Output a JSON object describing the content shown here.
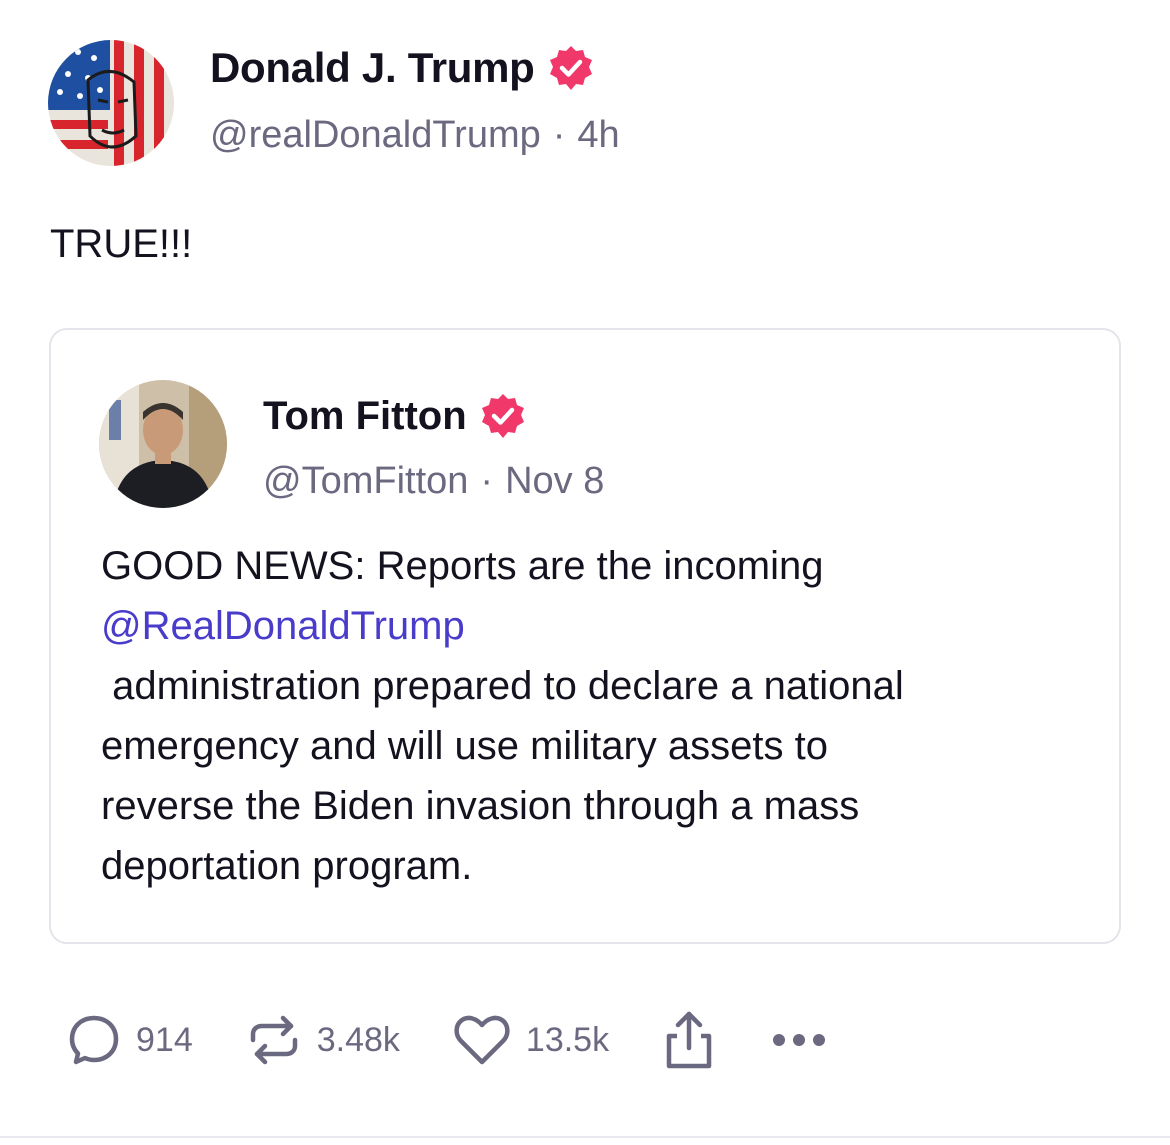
{
  "post": {
    "author": {
      "display_name": "Donald J. Trump",
      "handle": "@realDonaldTrump",
      "time": "4h",
      "verified_icon": "verified-badge-icon",
      "badge_color": "#f0386a"
    },
    "text": "TRUE!!!",
    "quoted": {
      "author": {
        "display_name": "Tom Fitton",
        "handle": "@TomFitton",
        "time": "Nov 8"
      },
      "lines": {
        "l1": "GOOD NEWS: Reports are the incoming",
        "mention": "@RealDonaldTrump",
        "l3": " administration prepared to declare a national",
        "l4": "emergency and will use military assets to",
        "l5": "reverse the Biden invasion through a mass",
        "l6": "deportation program."
      },
      "mention_color": "#4a3ccb"
    },
    "actions": {
      "replies": "914",
      "retruths": "3.48k",
      "likes": "13.5k"
    },
    "separator": "·"
  }
}
